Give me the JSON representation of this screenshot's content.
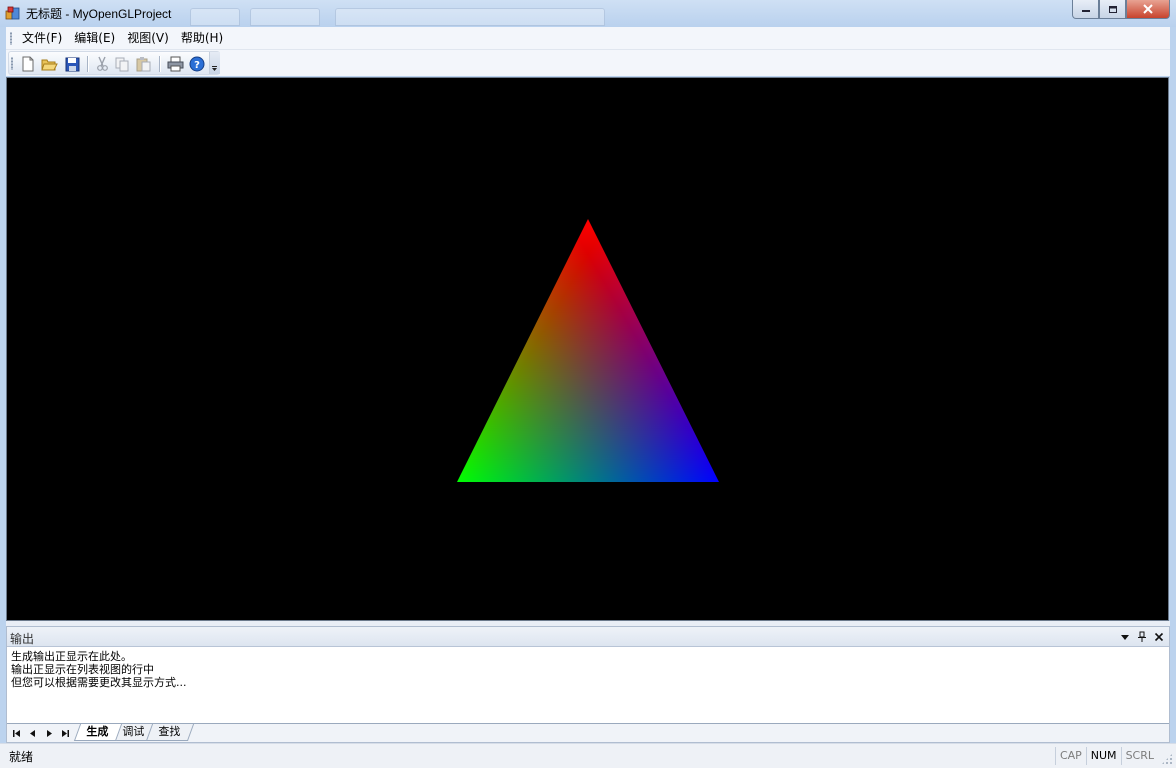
{
  "window": {
    "title": "无标题 - MyOpenGLProject",
    "controls": [
      "minimize",
      "maximize",
      "close"
    ]
  },
  "menu": {
    "items": [
      {
        "label": "文件(F)"
      },
      {
        "label": "编辑(E)"
      },
      {
        "label": "视图(V)"
      },
      {
        "label": "帮助(H)"
      }
    ]
  },
  "toolbar": {
    "buttons": [
      "new-file-icon",
      "open-folder-icon",
      "save-icon",
      "cut-icon",
      "copy-icon",
      "paste-icon",
      "print-icon",
      "help-icon"
    ]
  },
  "viewport": {
    "background": "#000000",
    "triangle": {
      "top_color": "#ff0000",
      "left_color": "#00ff00",
      "right_color": "#0000ff"
    }
  },
  "output": {
    "title": "输出",
    "lines": [
      "生成输出正显示在此处。",
      "输出正显示在列表视图的行中",
      "但您可以根据需要更改其显示方式..."
    ],
    "tabs": [
      {
        "label": "生成",
        "active": true
      },
      {
        "label": "调试",
        "active": false
      },
      {
        "label": "查找",
        "active": false
      }
    ]
  },
  "status": {
    "text": "就绪",
    "cap": "CAP",
    "num": "NUM",
    "scrl": "SCRL"
  }
}
